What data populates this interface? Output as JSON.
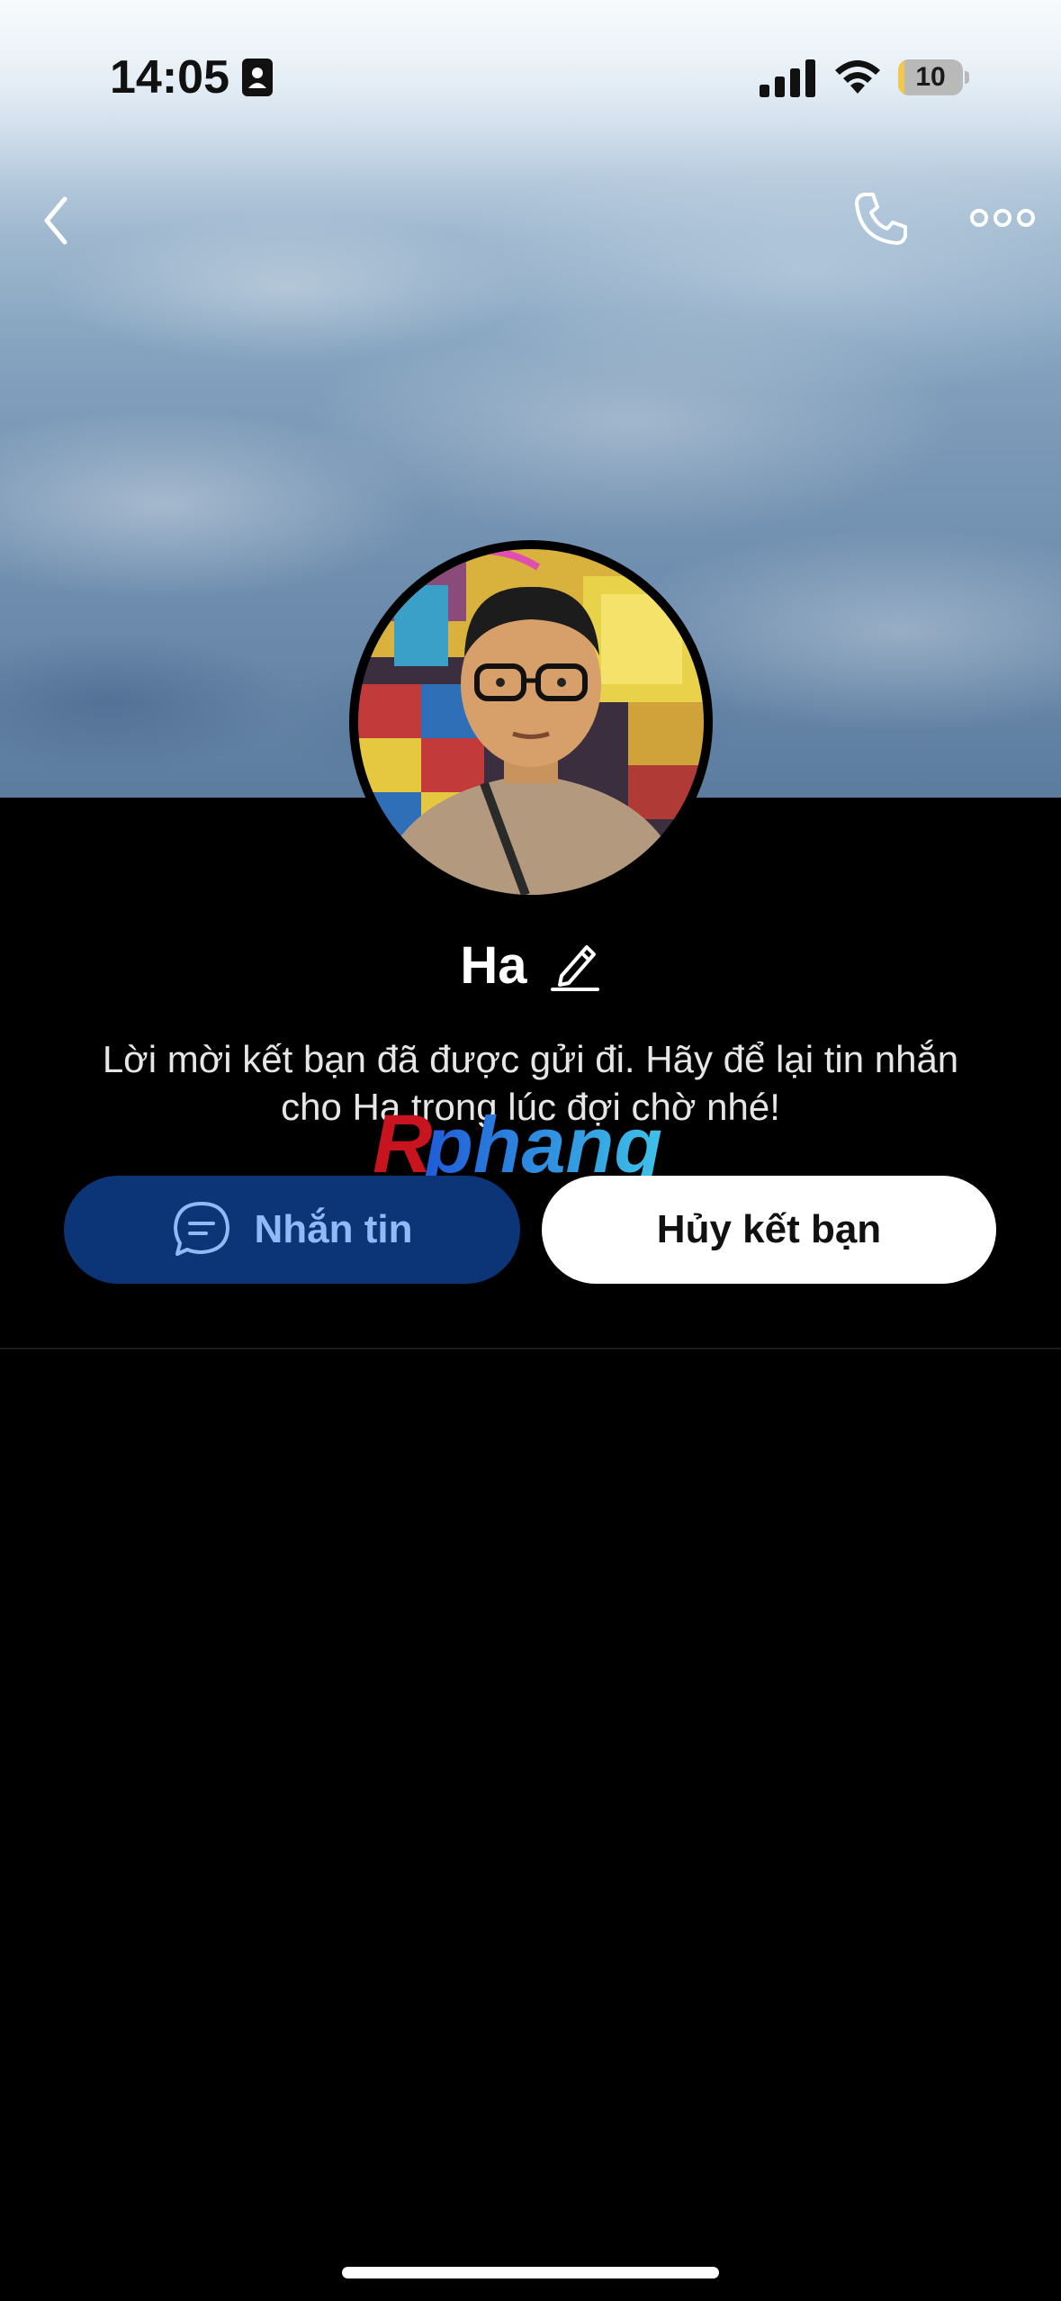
{
  "status_bar": {
    "time": "14:05",
    "battery_level": "10",
    "battery_fraction": 0.1
  },
  "nav": {
    "back_icon": "chevron-left-icon",
    "call_icon": "phone-icon",
    "more_icon": "more-horizontal-icon"
  },
  "profile": {
    "name": "Ha",
    "edit_icon": "pencil-icon",
    "message_line1": "Lời mời kết bạn đã được gửi đi. Hãy để lại tin nhắn",
    "message_line2": "cho Ha trong lúc đợi chờ nhé!"
  },
  "watermark": {
    "text": "Rphang"
  },
  "actions": {
    "message_label": "Nhắn tin",
    "unfriend_label": "Hủy kết bạn"
  },
  "colors": {
    "message_button_bg": "#0b3576",
    "message_button_text": "#8fb9f7",
    "unfriend_button_bg": "#ffffff",
    "battery_fill": "#f2c84b"
  }
}
